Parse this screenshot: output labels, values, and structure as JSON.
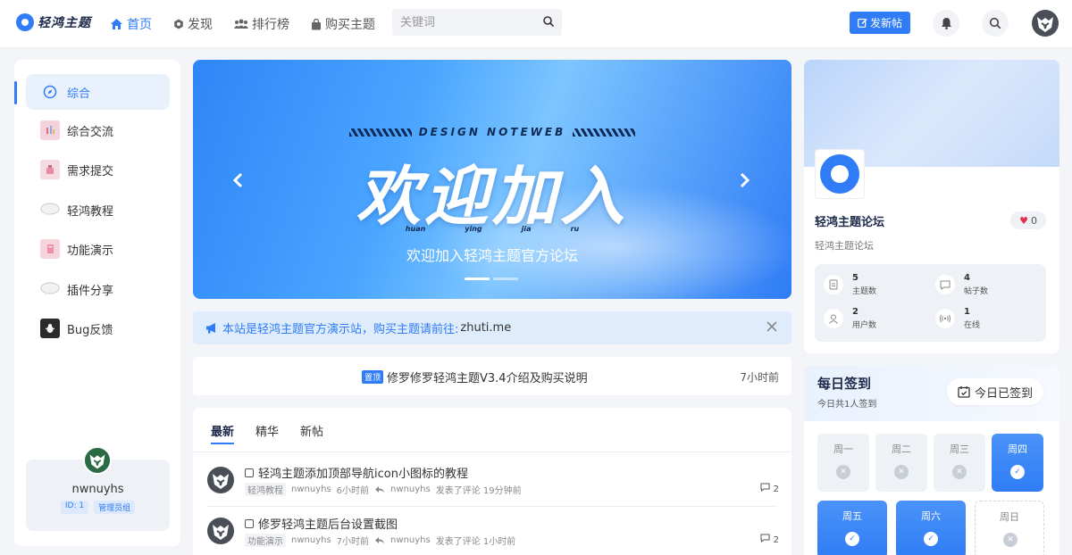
{
  "header": {
    "logo_text": "轻鸿主题",
    "nav": [
      {
        "label": "首页",
        "icon": "home-icon"
      },
      {
        "label": "发现",
        "icon": "discover-icon"
      },
      {
        "label": "排行榜",
        "icon": "ranking-icon"
      },
      {
        "label": "购买主题",
        "icon": "shop-icon"
      }
    ],
    "search_placeholder": "关键词",
    "post_button": "发新帖"
  },
  "sidebar": {
    "items": [
      {
        "label": "综合"
      },
      {
        "label": "综合交流"
      },
      {
        "label": "需求提交"
      },
      {
        "label": "轻鸿教程"
      },
      {
        "label": "功能演示"
      },
      {
        "label": "插件分享"
      },
      {
        "label": "Bug反馈"
      }
    ],
    "user": {
      "name": "nwnuyhs",
      "id_tag": "ID: 1",
      "role_tag": "管理员组"
    }
  },
  "banner": {
    "top_text": "DESIGN NOTEWEB",
    "title": "欢迎加入",
    "pinyin": [
      "huan",
      "ying",
      "jia",
      "ru"
    ],
    "caption": "欢迎加入轻鸿主题官方论坛"
  },
  "notice": {
    "text": "本站是轻鸿主题官方演示站，购买主题请前往:",
    "link": "zhuti.me"
  },
  "pinned": {
    "badge": "置顶",
    "title": "修罗修罗轻鸿主题V3.4介绍及购买说明",
    "time": "7小时前"
  },
  "posts": {
    "tabs": [
      "最新",
      "精华",
      "新帖"
    ],
    "items": [
      {
        "title": "轻鸿主题添加顶部导航icon小图标的教程",
        "category": "轻鸿教程",
        "author": "nwnuyhs",
        "time": "6小时前",
        "replier": "nwnuyhs",
        "reply_text": "发表了评论 19分钟前",
        "comments": "2"
      },
      {
        "title": "修罗轻鸿主题后台设置截图",
        "category": "功能演示",
        "author": "nwnuyhs",
        "time": "7小时前",
        "replier": "nwnuyhs",
        "reply_text": "发表了评论 1小时前",
        "comments": "2"
      }
    ]
  },
  "forum": {
    "name": "轻鸿主题论坛",
    "likes": "0",
    "desc": "轻鸿主题论坛",
    "stats": [
      {
        "num": "5",
        "label": "主题数"
      },
      {
        "num": "4",
        "label": "帖子数"
      },
      {
        "num": "2",
        "label": "用户数"
      },
      {
        "num": "1",
        "label": "在线"
      }
    ]
  },
  "signin": {
    "title": "每日签到",
    "sub": "今日共1人签到",
    "button": "今日已签到",
    "days": [
      {
        "label": "周一",
        "status": "missed"
      },
      {
        "label": "周二",
        "status": "missed"
      },
      {
        "label": "周三",
        "status": "missed"
      },
      {
        "label": "周四",
        "status": "done"
      },
      {
        "label": "周五",
        "status": "done"
      },
      {
        "label": "周六",
        "status": "done"
      },
      {
        "label": "周日",
        "status": "future"
      }
    ]
  },
  "colors": {
    "accent": "#2f7cf6",
    "background": "#f3f5f8",
    "heart": "#e0334b"
  }
}
